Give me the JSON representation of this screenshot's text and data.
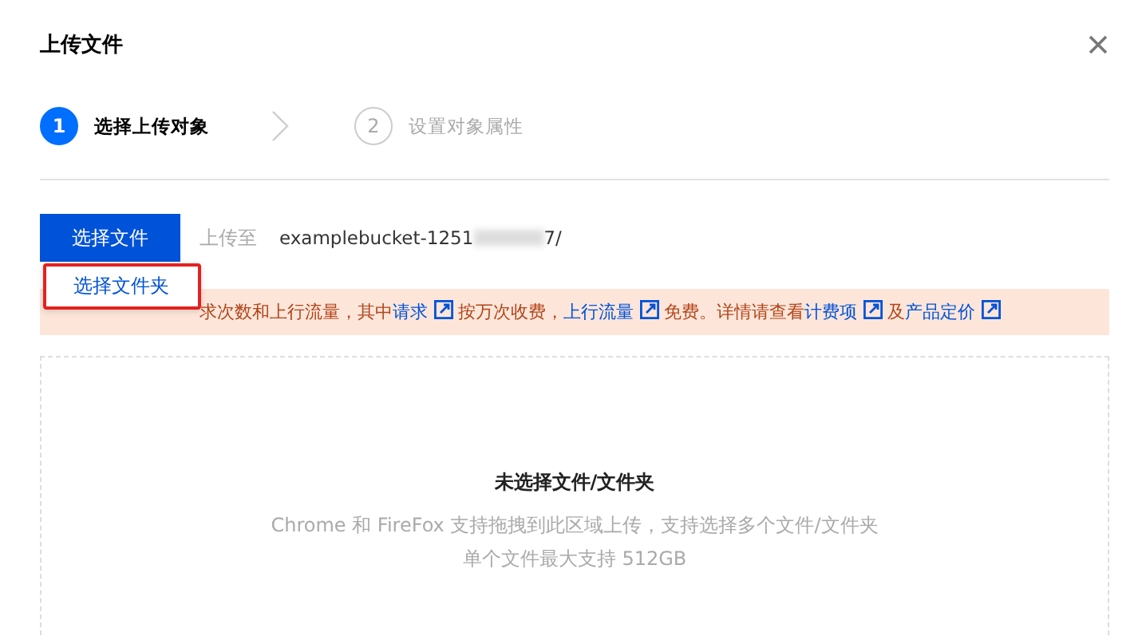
{
  "dialog": {
    "title": "上传文件"
  },
  "steps": [
    {
      "number": "1",
      "label": "选择上传对象",
      "selected": true
    },
    {
      "number": "2",
      "label": "设置对象属性",
      "selected": false
    }
  ],
  "toolbar": {
    "button": "选择文件",
    "target_label": "上传至",
    "bucket_prefix": "examplebucket-1251",
    "bucket_suffix": "7/"
  },
  "dropdown": {
    "items": [
      {
        "label": "选择文件夹",
        "highlighted": true
      }
    ]
  },
  "notice": {
    "parts": [
      {
        "kind": "text",
        "text": "求次数和上行流量，其中"
      },
      {
        "kind": "link",
        "text": "请求"
      },
      {
        "kind": "text",
        "text": "按万次收费，"
      },
      {
        "kind": "link",
        "text": "上行流量"
      },
      {
        "kind": "text",
        "text": "免费。详情请查看"
      },
      {
        "kind": "link",
        "text": "计费项"
      },
      {
        "kind": "text",
        "text": "及"
      },
      {
        "kind": "link",
        "text": "产品定价"
      }
    ]
  },
  "dropzone": {
    "title": "未选择文件/文件夹",
    "lines": [
      "Chrome 和 FireFox 支持拖拽到此区域上传，支持选择多个文件/文件夹",
      "单个文件最大支持 512GB"
    ]
  }
}
